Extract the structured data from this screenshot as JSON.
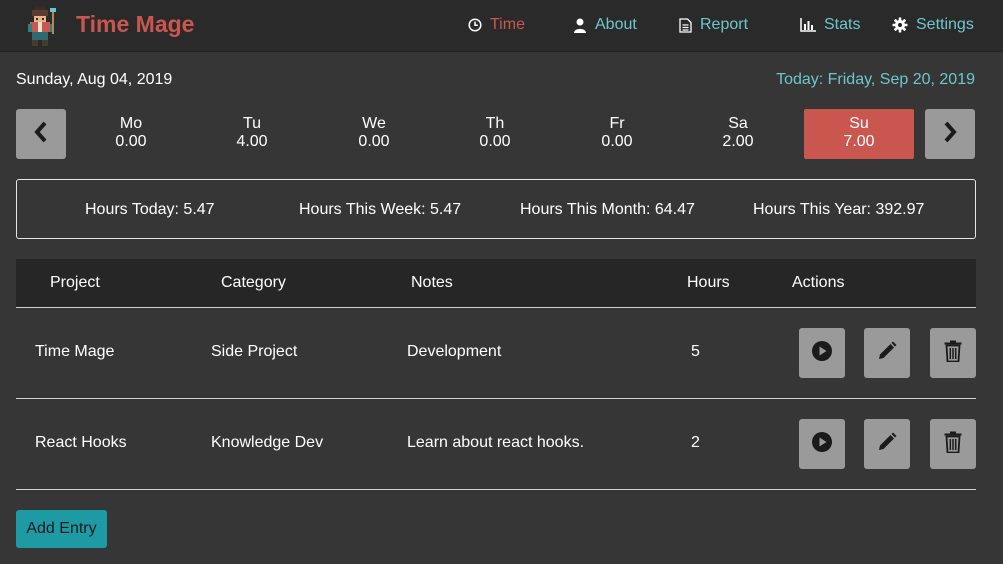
{
  "app": {
    "name": "Time Mage",
    "brand_color": "#c9574f",
    "accent_color": "#6ec6cd"
  },
  "nav": {
    "items": [
      {
        "label": "Time",
        "icon": "clock-icon",
        "active": true
      },
      {
        "label": "About",
        "icon": "user-icon",
        "active": false
      },
      {
        "label": "Report",
        "icon": "document-icon",
        "active": false
      },
      {
        "label": "Stats",
        "icon": "bar-chart-icon",
        "active": false
      },
      {
        "label": "Settings",
        "icon": "gear-icon",
        "active": false
      }
    ]
  },
  "date": {
    "current": "Sunday, Aug 04, 2019",
    "today": "Today: Friday, Sep 20, 2019"
  },
  "week": {
    "prev_icon": "chevron-left-icon",
    "next_icon": "chevron-right-icon",
    "days": [
      {
        "name": "Mo",
        "hours": "0.00",
        "active": false
      },
      {
        "name": "Tu",
        "hours": "4.00",
        "active": false
      },
      {
        "name": "We",
        "hours": "0.00",
        "active": false
      },
      {
        "name": "Th",
        "hours": "0.00",
        "active": false
      },
      {
        "name": "Fr",
        "hours": "0.00",
        "active": false
      },
      {
        "name": "Sa",
        "hours": "2.00",
        "active": false
      },
      {
        "name": "Su",
        "hours": "7.00",
        "active": true
      }
    ]
  },
  "summary": {
    "today": "Hours Today: 5.47",
    "week": "Hours This Week: 5.47",
    "month": "Hours This Month: 64.47",
    "year": "Hours This Year: 392.97"
  },
  "table": {
    "headers": {
      "project": "Project",
      "category": "Category",
      "notes": "Notes",
      "hours": "Hours",
      "actions": "Actions"
    },
    "rows": [
      {
        "project": "Time Mage",
        "category": "Side Project",
        "notes": "Development",
        "hours": "5"
      },
      {
        "project": "React Hooks",
        "category": "Knowledge Dev",
        "notes": "Learn about react hooks.",
        "hours": "2"
      }
    ],
    "row_actions": [
      "play-icon",
      "pencil-icon",
      "trash-icon"
    ]
  },
  "add_entry": {
    "label": "Add Entry"
  }
}
